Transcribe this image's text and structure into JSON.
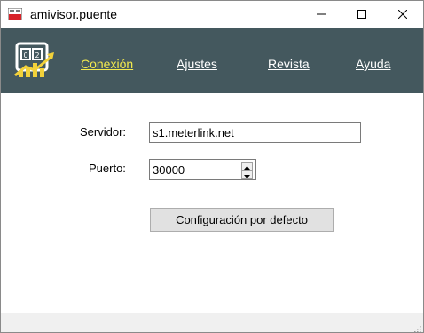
{
  "window": {
    "title": "amivisor.puente",
    "controls": {
      "minimize_icon": "minimize-icon",
      "maximize_icon": "maximize-icon",
      "close_icon": "close-icon"
    }
  },
  "nav": {
    "logo_icon": "meter-chart-logo-icon",
    "items": [
      {
        "label": "Conexión",
        "active": true
      },
      {
        "label": "Ajustes",
        "active": false
      },
      {
        "label": "Revista",
        "active": false
      },
      {
        "label": "Ayuda",
        "active": false
      }
    ],
    "colors": {
      "background": "#44585e",
      "active_link": "#f2e94e",
      "link": "#ffffff"
    }
  },
  "form": {
    "server_label": "Servidor:",
    "server_value": "s1.meterlink.net",
    "port_label": "Puerto:",
    "port_value": "30000",
    "default_button": "Configuración por defecto"
  }
}
